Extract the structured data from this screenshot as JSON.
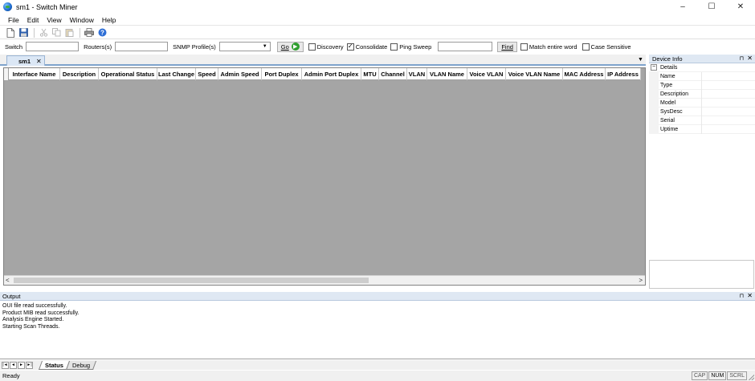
{
  "window": {
    "title": "sm1 - Switch Miner",
    "controls": {
      "minimize": "–",
      "maximize": "☐",
      "close": "✕"
    }
  },
  "menu": {
    "items": [
      "File",
      "Edit",
      "View",
      "Window",
      "Help"
    ]
  },
  "toolbar": {
    "icons": [
      "new-icon",
      "save-icon",
      "cut-icon",
      "copy-icon",
      "paste-icon",
      "print-icon",
      "help-icon"
    ]
  },
  "filter": {
    "switch_label": "Switch",
    "switch_value": "",
    "routers_label": "Routers(s)",
    "routers_value": "",
    "snmp_label": "SNMP Profile(s)",
    "snmp_value": "",
    "go_label": "Go",
    "discovery_label": "Discovery",
    "discovery_checked": false,
    "consolidate_label": "Consolidate",
    "consolidate_checked": true,
    "pingsweep_label": "Ping Sweep",
    "pingsweep_checked": false,
    "find_value": "",
    "find_label": "Find",
    "matchword_label": "Match entire word",
    "matchword_checked": false,
    "casesensitive_label": "Case Sensitive",
    "casesensitive_checked": false
  },
  "document": {
    "tab_label": "sm1",
    "tab_close": "✕",
    "dropdown": "▼"
  },
  "grid": {
    "columns": [
      "Interface Name",
      "Description",
      "Operational Status",
      "Last Change",
      "Speed",
      "Admin Speed",
      "Port Duplex",
      "Admin Port Duplex",
      "MTU",
      "Channel",
      "VLAN",
      "VLAN Name",
      "Voice VLAN",
      "Voice VLAN Name",
      "MAC Address",
      "IP Address"
    ],
    "scroll_left": "<",
    "scroll_right": ">"
  },
  "device_info": {
    "title": "Device Info",
    "pin": "⊓",
    "close": "✕",
    "category": "Details",
    "category_toggle": "−",
    "properties": [
      "Name",
      "Type",
      "Description",
      "Model",
      "SysDesc",
      "Serial",
      "Uptime"
    ]
  },
  "output": {
    "title": "Output",
    "pin": "⊓",
    "close": "✕",
    "lines": [
      "OUI file read successfully.",
      "Product MIB read successfully.",
      "Analysis Engine Started.",
      "Starting Scan Threads."
    ]
  },
  "sheet_tabs": {
    "nav": [
      "|◄",
      "◄",
      "►",
      "►|"
    ],
    "tabs": [
      "Status",
      "Debug"
    ],
    "active": "Status"
  },
  "status": {
    "text": "Ready",
    "indicators": [
      {
        "label": "CAP",
        "on": false
      },
      {
        "label": "NUM",
        "on": true
      },
      {
        "label": "SCRL",
        "on": false
      }
    ]
  }
}
